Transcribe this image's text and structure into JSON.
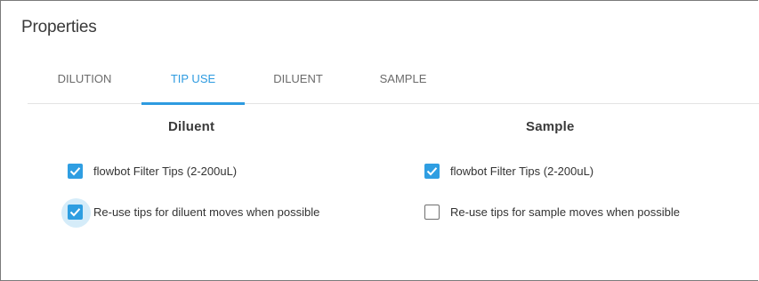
{
  "panel": {
    "title": "Properties"
  },
  "tabs": [
    {
      "label": "DILUTION",
      "active": false
    },
    {
      "label": "TIP USE",
      "active": true
    },
    {
      "label": "DILUENT",
      "active": false
    },
    {
      "label": "SAMPLE",
      "active": false
    }
  ],
  "diluent": {
    "heading": "Diluent",
    "options": [
      {
        "label": "flowbot Filter Tips (2-200uL)",
        "checked": true
      },
      {
        "label": "Re-use tips for diluent moves when possible",
        "checked": true
      }
    ]
  },
  "sample": {
    "heading": "Sample",
    "options": [
      {
        "label": "flowbot Filter Tips (2-200uL)",
        "checked": true
      },
      {
        "label": "Re-use tips for sample moves when possible",
        "checked": false
      }
    ]
  },
  "colors": {
    "accent": "#2e9be0",
    "checkbox_checked": "#2f9ee2",
    "text": "#333333"
  }
}
